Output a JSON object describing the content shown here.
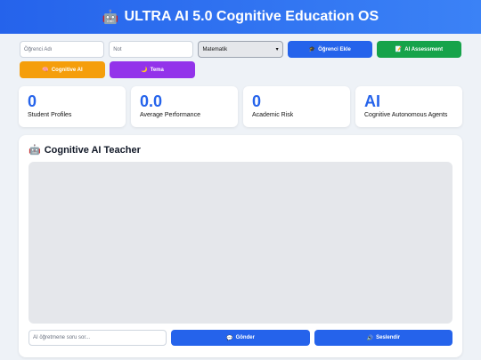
{
  "header": {
    "icon": "robot-icon",
    "title": "ULTRA AI 5.0 Cognitive Education OS"
  },
  "form": {
    "student_placeholder": "Öğrenci Adı",
    "grade_placeholder": "Not",
    "subject_selected": "Matematik",
    "add_student_label": "Öğrenci Ekle",
    "add_student_icon": "🎓",
    "assessment_label": "AI Assessment",
    "assessment_icon": "📝",
    "cognitive_label": "Cognitive AI",
    "cognitive_icon": "🧠",
    "theme_label": "Tema",
    "theme_icon": "🌙"
  },
  "stats": [
    {
      "value": "0",
      "label": "Student Profiles"
    },
    {
      "value": "0.0",
      "label": "Average Performance"
    },
    {
      "value": "0",
      "label": "Academic Risk"
    },
    {
      "value": "AI",
      "label": "Cognitive Autonomous Agents"
    }
  ],
  "teacher": {
    "icon": "🤖",
    "title": "Cognitive AI Teacher",
    "input_placeholder": "AI öğretmene soru sor...",
    "send_label": "Gönder",
    "send_icon": "💬",
    "speak_label": "Seslendir",
    "speak_icon": "🔊"
  },
  "colors": {
    "accent": "#2563eb",
    "green": "#16a34a",
    "orange": "#f59e0b",
    "purple": "#9333ea"
  }
}
